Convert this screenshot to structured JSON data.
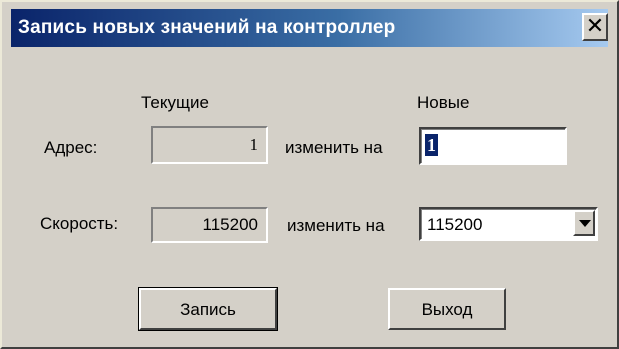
{
  "window": {
    "title": "Запись новых значений на контроллер",
    "close_glyph": "✕"
  },
  "headers": {
    "current": "Текущие",
    "new": "Новые"
  },
  "address": {
    "label": "Адрес:",
    "current_value": "1",
    "change_label": "изменить на",
    "new_value": "1"
  },
  "speed": {
    "label": "Скорость:",
    "current_value": "115200",
    "change_label": "изменить на",
    "new_value": "115200"
  },
  "buttons": {
    "write": "Запись",
    "exit": "Выход"
  },
  "icons": {
    "close": "close-icon",
    "dropdown": "chevron-down-icon"
  },
  "colors": {
    "title_start": "#0a246a",
    "title_end": "#a6caf0",
    "face": "#d4d0c8",
    "selection": "#0a246a"
  }
}
